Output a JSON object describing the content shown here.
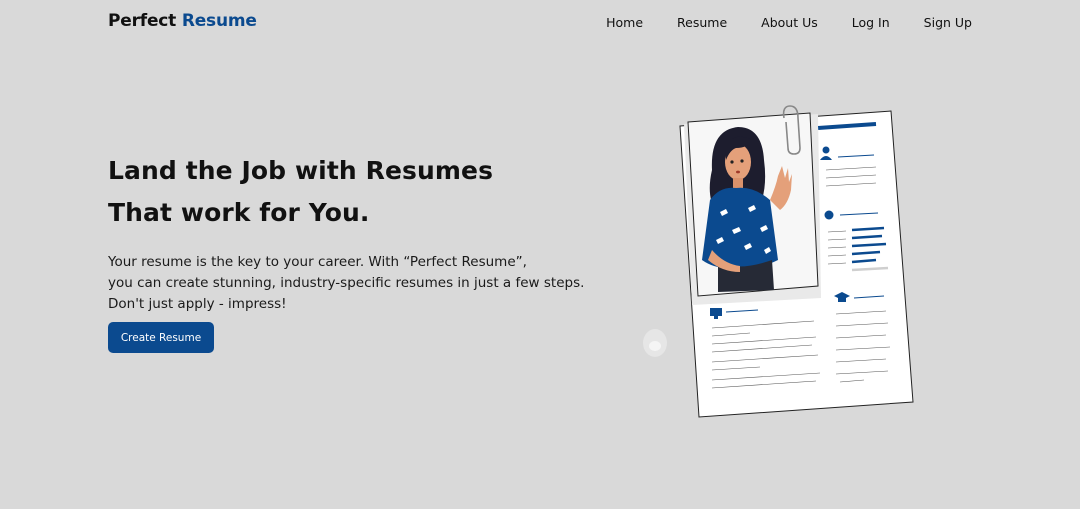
{
  "brand": {
    "name_part1": "Perfect",
    "name_part2": "Resume",
    "accent_color": "#0b4a8f"
  },
  "nav": {
    "items": [
      {
        "label": "Home"
      },
      {
        "label": "Resume"
      },
      {
        "label": "About Us"
      },
      {
        "label": "Log In"
      },
      {
        "label": "Sign Up"
      }
    ]
  },
  "hero": {
    "headline_line1": "Land the Job with Resumes",
    "headline_line2": "That work for You.",
    "description_line1": "Your resume is the key to your career. With “Perfect Resume”,",
    "description_line2": "you can create stunning, industry-specific resumes in just a few steps.",
    "description_line3": "Don't just apply - impress!",
    "cta_label": "Create Resume"
  },
  "illustration": {
    "icons": [
      "paperclip-icon",
      "person-icon",
      "location-icon",
      "monitor-icon",
      "graduation-cap-icon"
    ]
  },
  "colors": {
    "background": "#d9d9d9",
    "primary": "#0b4a8f",
    "text": "#111111"
  }
}
